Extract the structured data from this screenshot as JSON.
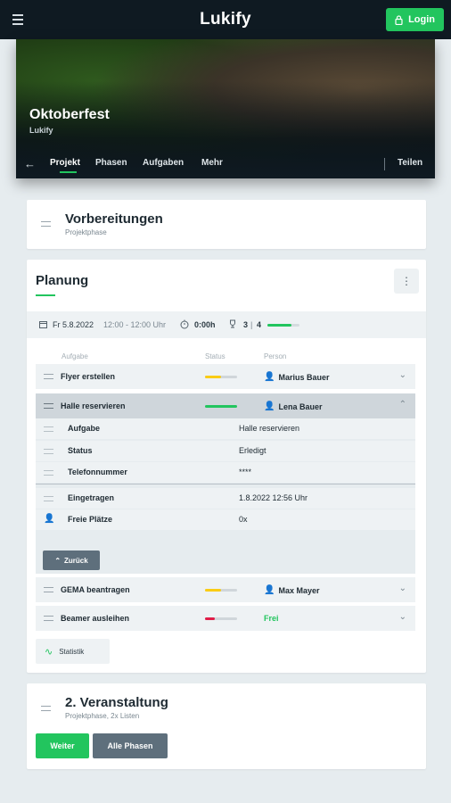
{
  "app": {
    "title": "Lukify",
    "login_label": "Login"
  },
  "hero": {
    "title": "Oktoberfest",
    "subtitle": "Lukify",
    "tabs": [
      {
        "label": "Projekt",
        "active": true
      },
      {
        "label": "Phasen"
      },
      {
        "label": "Aufgaben"
      },
      {
        "label": "Mehr"
      }
    ],
    "share_label": "Teilen"
  },
  "phase1": {
    "title": "Vorbereitungen",
    "subtitle": "Projektphase"
  },
  "planung": {
    "title": "Planung",
    "meta": {
      "date": "Fr 5.8.2022",
      "time": "12:00 - 12:00 Uhr",
      "duration": "0:00h",
      "done_count": "3",
      "total_count": "4",
      "progress": 0.75
    },
    "columns": {
      "task": "Aufgabe",
      "status": "Status",
      "person": "Person"
    },
    "tasks": [
      {
        "name": "Flyer erstellen",
        "status_color": "#facc15",
        "status_fraction": 0.5,
        "person": "Marius Bauer"
      },
      {
        "name": "Halle reservieren",
        "status_color": "#22c55e",
        "status_fraction": 1.0,
        "person": "Lena Bauer"
      },
      {
        "name": "GEMA beantragen",
        "status_color": "#facc15",
        "status_fraction": 0.5,
        "person": "Max Mayer"
      },
      {
        "name": "Beamer ausleihen",
        "status_color": "#e11d48",
        "status_fraction": 0.3,
        "person": "Frei"
      }
    ],
    "details": [
      {
        "label": "Aufgabe",
        "value": "Halle reservieren"
      },
      {
        "label": "Status",
        "value": "Erledigt"
      },
      {
        "label": "Telefonnummer",
        "value": "****"
      },
      {
        "label": "Eingetragen",
        "value": "1.8.2022 12:56 Uhr"
      },
      {
        "label": "Freie Plätze",
        "value": "0x"
      }
    ],
    "back_label": "Zurück",
    "stats_label": "Statistik"
  },
  "phase3": {
    "title": "2. Veranstaltung",
    "subtitle": "Projektphase, 2x Listen",
    "next_label": "Weiter",
    "all_label": "Alle Phasen"
  },
  "colors": {
    "accent": "#22c55e",
    "dark": "#0f1a22",
    "secondary_button": "#5e6f7c",
    "warning": "#facc15",
    "danger": "#e11d48",
    "link": "#3b82f6"
  }
}
